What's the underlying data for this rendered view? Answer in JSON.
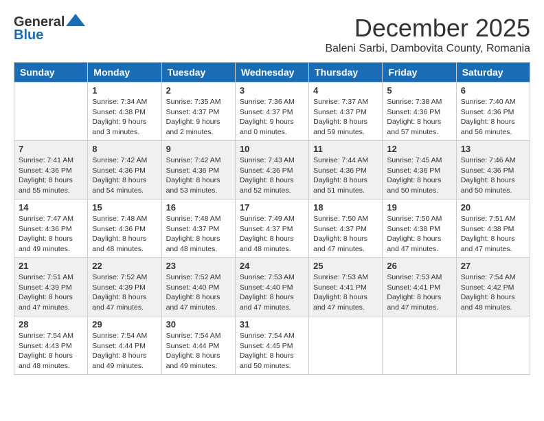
{
  "header": {
    "logo_general": "General",
    "logo_blue": "Blue",
    "month_title": "December 2025",
    "location": "Baleni Sarbi, Dambovita County, Romania"
  },
  "days_of_week": [
    "Sunday",
    "Monday",
    "Tuesday",
    "Wednesday",
    "Thursday",
    "Friday",
    "Saturday"
  ],
  "weeks": [
    [
      {
        "day": "",
        "info": ""
      },
      {
        "day": "1",
        "info": "Sunrise: 7:34 AM\nSunset: 4:38 PM\nDaylight: 9 hours\nand 3 minutes."
      },
      {
        "day": "2",
        "info": "Sunrise: 7:35 AM\nSunset: 4:37 PM\nDaylight: 9 hours\nand 2 minutes."
      },
      {
        "day": "3",
        "info": "Sunrise: 7:36 AM\nSunset: 4:37 PM\nDaylight: 9 hours\nand 0 minutes."
      },
      {
        "day": "4",
        "info": "Sunrise: 7:37 AM\nSunset: 4:37 PM\nDaylight: 8 hours\nand 59 minutes."
      },
      {
        "day": "5",
        "info": "Sunrise: 7:38 AM\nSunset: 4:36 PM\nDaylight: 8 hours\nand 57 minutes."
      },
      {
        "day": "6",
        "info": "Sunrise: 7:40 AM\nSunset: 4:36 PM\nDaylight: 8 hours\nand 56 minutes."
      }
    ],
    [
      {
        "day": "7",
        "info": "Sunrise: 7:41 AM\nSunset: 4:36 PM\nDaylight: 8 hours\nand 55 minutes."
      },
      {
        "day": "8",
        "info": "Sunrise: 7:42 AM\nSunset: 4:36 PM\nDaylight: 8 hours\nand 54 minutes."
      },
      {
        "day": "9",
        "info": "Sunrise: 7:42 AM\nSunset: 4:36 PM\nDaylight: 8 hours\nand 53 minutes."
      },
      {
        "day": "10",
        "info": "Sunrise: 7:43 AM\nSunset: 4:36 PM\nDaylight: 8 hours\nand 52 minutes."
      },
      {
        "day": "11",
        "info": "Sunrise: 7:44 AM\nSunset: 4:36 PM\nDaylight: 8 hours\nand 51 minutes."
      },
      {
        "day": "12",
        "info": "Sunrise: 7:45 AM\nSunset: 4:36 PM\nDaylight: 8 hours\nand 50 minutes."
      },
      {
        "day": "13",
        "info": "Sunrise: 7:46 AM\nSunset: 4:36 PM\nDaylight: 8 hours\nand 50 minutes."
      }
    ],
    [
      {
        "day": "14",
        "info": "Sunrise: 7:47 AM\nSunset: 4:36 PM\nDaylight: 8 hours\nand 49 minutes."
      },
      {
        "day": "15",
        "info": "Sunrise: 7:48 AM\nSunset: 4:36 PM\nDaylight: 8 hours\nand 48 minutes."
      },
      {
        "day": "16",
        "info": "Sunrise: 7:48 AM\nSunset: 4:37 PM\nDaylight: 8 hours\nand 48 minutes."
      },
      {
        "day": "17",
        "info": "Sunrise: 7:49 AM\nSunset: 4:37 PM\nDaylight: 8 hours\nand 48 minutes."
      },
      {
        "day": "18",
        "info": "Sunrise: 7:50 AM\nSunset: 4:37 PM\nDaylight: 8 hours\nand 47 minutes."
      },
      {
        "day": "19",
        "info": "Sunrise: 7:50 AM\nSunset: 4:38 PM\nDaylight: 8 hours\nand 47 minutes."
      },
      {
        "day": "20",
        "info": "Sunrise: 7:51 AM\nSunset: 4:38 PM\nDaylight: 8 hours\nand 47 minutes."
      }
    ],
    [
      {
        "day": "21",
        "info": "Sunrise: 7:51 AM\nSunset: 4:39 PM\nDaylight: 8 hours\nand 47 minutes."
      },
      {
        "day": "22",
        "info": "Sunrise: 7:52 AM\nSunset: 4:39 PM\nDaylight: 8 hours\nand 47 minutes."
      },
      {
        "day": "23",
        "info": "Sunrise: 7:52 AM\nSunset: 4:40 PM\nDaylight: 8 hours\nand 47 minutes."
      },
      {
        "day": "24",
        "info": "Sunrise: 7:53 AM\nSunset: 4:40 PM\nDaylight: 8 hours\nand 47 minutes."
      },
      {
        "day": "25",
        "info": "Sunrise: 7:53 AM\nSunset: 4:41 PM\nDaylight: 8 hours\nand 47 minutes."
      },
      {
        "day": "26",
        "info": "Sunrise: 7:53 AM\nSunset: 4:41 PM\nDaylight: 8 hours\nand 47 minutes."
      },
      {
        "day": "27",
        "info": "Sunrise: 7:54 AM\nSunset: 4:42 PM\nDaylight: 8 hours\nand 48 minutes."
      }
    ],
    [
      {
        "day": "28",
        "info": "Sunrise: 7:54 AM\nSunset: 4:43 PM\nDaylight: 8 hours\nand 48 minutes."
      },
      {
        "day": "29",
        "info": "Sunrise: 7:54 AM\nSunset: 4:44 PM\nDaylight: 8 hours\nand 49 minutes."
      },
      {
        "day": "30",
        "info": "Sunrise: 7:54 AM\nSunset: 4:44 PM\nDaylight: 8 hours\nand 49 minutes."
      },
      {
        "day": "31",
        "info": "Sunrise: 7:54 AM\nSunset: 4:45 PM\nDaylight: 8 hours\nand 50 minutes."
      },
      {
        "day": "",
        "info": ""
      },
      {
        "day": "",
        "info": ""
      },
      {
        "day": "",
        "info": ""
      }
    ]
  ]
}
